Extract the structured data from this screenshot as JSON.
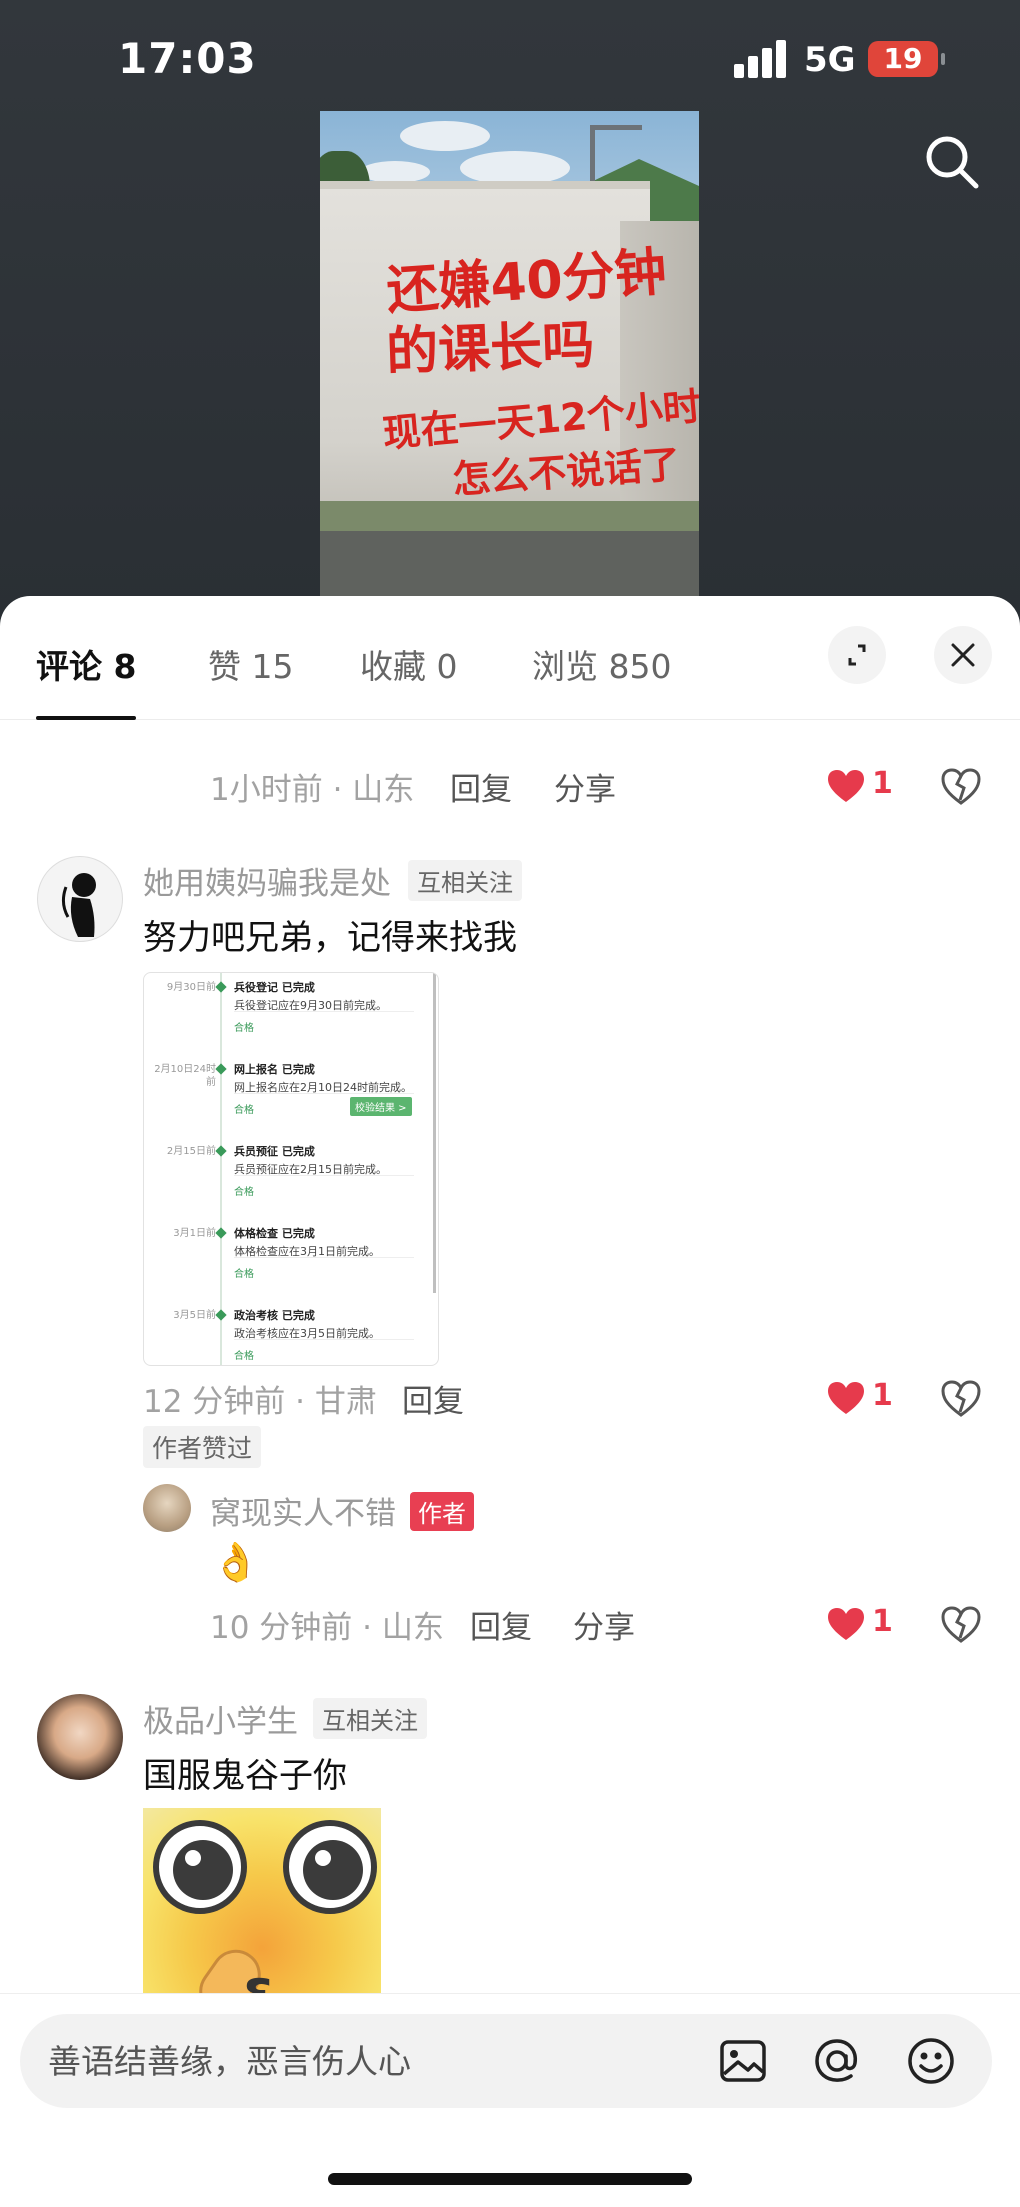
{
  "status_bar": {
    "time": "17:03",
    "network": "5G",
    "battery": "19"
  },
  "poster": {
    "lines": [
      "还嫌40分钟",
      "的课长吗",
      "现在一天12个小时",
      "怎么不说话了"
    ]
  },
  "tabs": [
    {
      "label": "评论 8",
      "active": true
    },
    {
      "label": "赞 15",
      "active": false
    },
    {
      "label": "收藏 0",
      "active": false
    },
    {
      "label": "浏览 850",
      "active": false
    }
  ],
  "comments": {
    "prev": {
      "meta": "1小时前 · 山东",
      "reply": "回复",
      "share": "分享",
      "likes": "1"
    },
    "c1": {
      "username": "她用姨妈骗我是处",
      "tag": "互相关注",
      "content": "努力吧兄弟，记得来找我",
      "meta": "12 分钟前 · 甘肃",
      "reply": "回复",
      "likes": "1",
      "author_liked": "作者赞过",
      "screenshot": {
        "steps": [
          {
            "date": "9月30日前",
            "title": "兵役登记 已完成",
            "desc": "兵役登记应在9月30日前完成。",
            "status": "合格"
          },
          {
            "date": "2月10日24时前",
            "title": "网上报名 已完成",
            "desc": "网上报名应在2月10日24时前完成。",
            "status": "合格",
            "button": "校验结果 >"
          },
          {
            "date": "2月15日前",
            "title": "兵员预征 已完成",
            "desc": "兵员预征应在2月15日前完成。",
            "status": "合格"
          },
          {
            "date": "3月1日前",
            "title": "体格检查 已完成",
            "desc": "体格检查应在3月1日前完成。",
            "status": "合格"
          },
          {
            "date": "3月5日前",
            "title": "政治考核 已完成",
            "desc": "政治考核应在3月5日前完成。",
            "status": "合格"
          }
        ]
      },
      "reply_item": {
        "username": "窝现实人不错",
        "tag": "作者",
        "content": "👌",
        "meta": "10 分钟前 · 山东",
        "reply": "回复",
        "share": "分享",
        "likes": "1"
      }
    },
    "c2": {
      "username": "极品小学生",
      "tag": "互相关注",
      "content": "国服鬼谷子你"
    }
  },
  "input": {
    "placeholder": "善语结善缘，恶言伤人心"
  },
  "colors": {
    "accent_red": "#e63a4c",
    "author_tag": "#e83f52",
    "battery_red": "#e0453a"
  },
  "icons": [
    "search-icon",
    "expand-icon",
    "close-icon",
    "heart-icon",
    "broken-heart-icon",
    "image-icon",
    "at-icon",
    "emoji-icon"
  ]
}
